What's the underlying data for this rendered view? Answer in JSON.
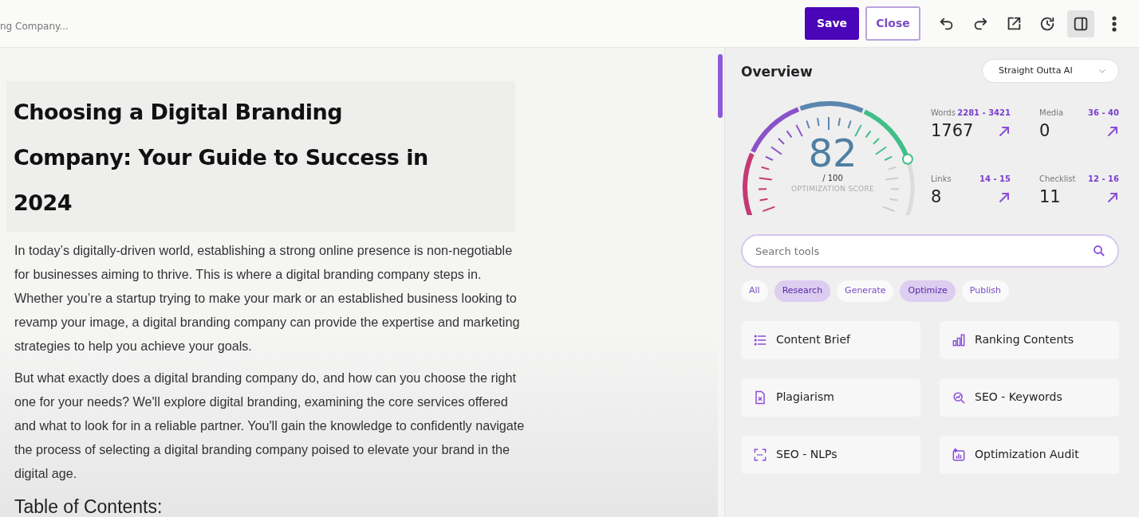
{
  "topbar": {
    "doc_title": "ng Company...",
    "save": "Save",
    "close": "Close",
    "tools": [
      {
        "kind": "undo",
        "active": false
      },
      {
        "kind": "redo",
        "active": false
      },
      {
        "kind": "open",
        "active": false
      },
      {
        "kind": "history",
        "active": false
      },
      {
        "kind": "panel",
        "active": true
      },
      {
        "kind": "more",
        "active": false
      }
    ]
  },
  "editor": {
    "title": "Choosing a Digital Branding Company: Your Guide to Success in 2024",
    "paragraphs": [
      "In today’s digitally-driven world, establishing a strong online presence is non-negotiable for businesses aiming to thrive. This is where a digital branding company steps in. Whether you’re a startup trying to make your mark or an established business looking to revamp your image, a digital branding company can provide the expertise and marketing strategies to help you achieve your goals.",
      "But what exactly does a digital branding company do, and how can you choose the right one for your needs? We'll explore digital branding, examining the core services offered and what to look for in a reliable partner. You'll gain the knowledge to confidently navigate the process of selecting a digital branding company poised to elevate your brand in the digital age."
    ],
    "heading": "Table of Contents:"
  },
  "overview": {
    "title": "Overview",
    "preset": "Straight Outta AI",
    "score": {
      "value": "82",
      "max": "/ 100",
      "label": "OPTIMIZATION SCORE"
    },
    "stats": [
      {
        "label": "Words",
        "range": "2281 - 3421",
        "value": "1767"
      },
      {
        "label": "Media",
        "range": "36 - 40",
        "value": "0"
      },
      {
        "label": "Links",
        "range": "14 - 15",
        "value": "8"
      },
      {
        "label": "Checklist",
        "range": "12 - 16",
        "value": "11"
      }
    ]
  },
  "search": {
    "placeholder": "Search tools"
  },
  "filters": [
    {
      "label": "All",
      "selected": false
    },
    {
      "label": "Research",
      "selected": true
    },
    {
      "label": "Generate",
      "selected": false
    },
    {
      "label": "Optimize",
      "selected": true
    },
    {
      "label": "Publish",
      "selected": false
    }
  ],
  "tools": [
    {
      "label": "Content Brief",
      "kind": "list"
    },
    {
      "label": "Ranking Contents",
      "kind": "bars"
    },
    {
      "label": "Plagiarism",
      "kind": "file"
    },
    {
      "label": "SEO - Keywords",
      "kind": "magnifier"
    },
    {
      "label": "SEO - NLPs",
      "kind": "scan"
    },
    {
      "label": "Optimization Audit",
      "kind": "audit"
    }
  ]
}
